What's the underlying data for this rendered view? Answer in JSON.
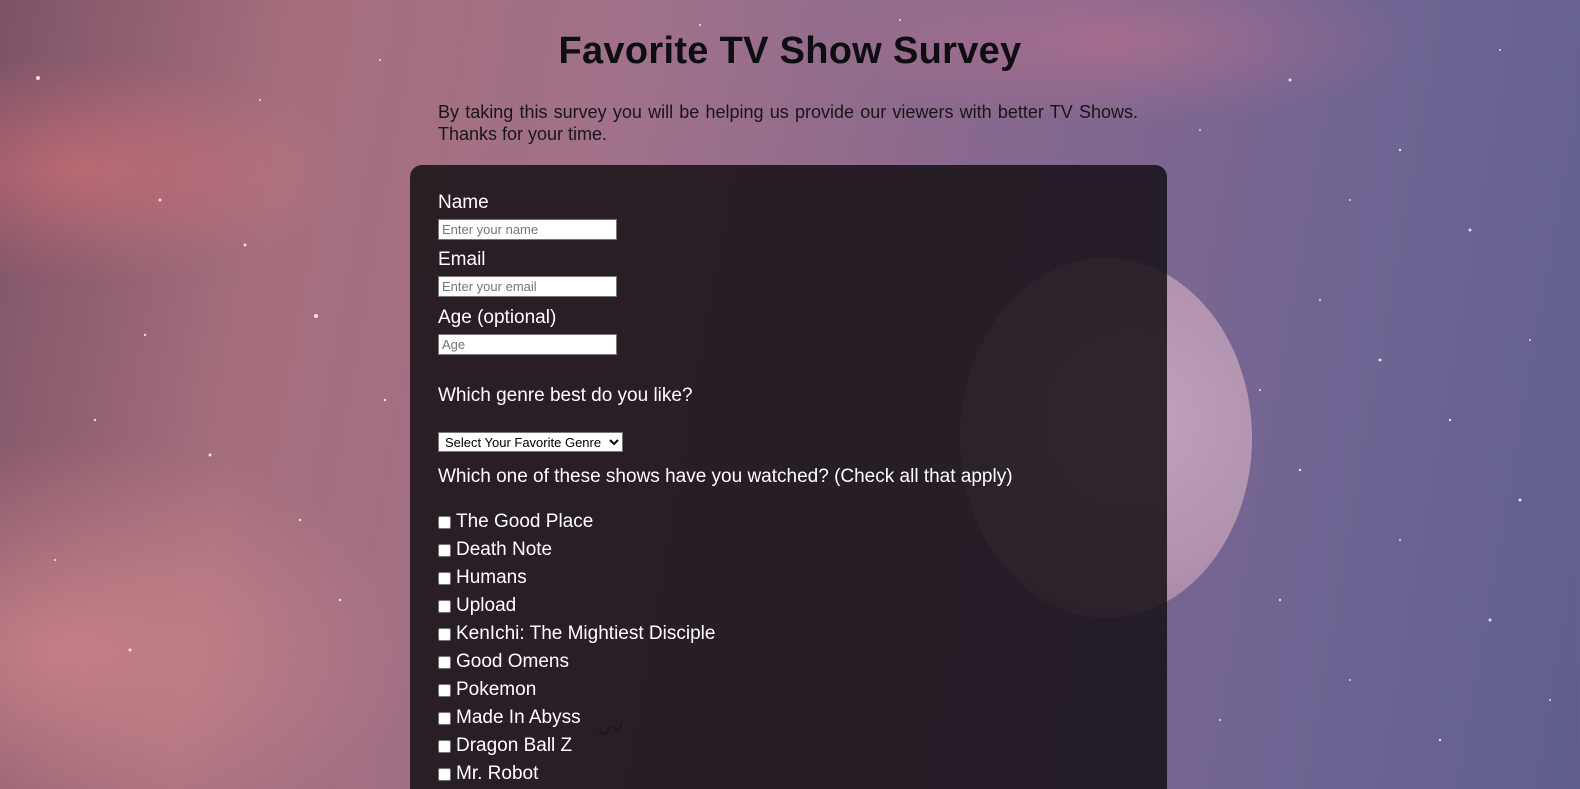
{
  "header": {
    "title": "Favorite TV Show Survey",
    "description": "By taking this survey you will be helping us provide our viewers with better TV Shows. Thanks for your time."
  },
  "form": {
    "name": {
      "label": "Name",
      "placeholder": "Enter your name"
    },
    "email": {
      "label": "Email",
      "placeholder": "Enter your email"
    },
    "age": {
      "label": "Age (optional)",
      "placeholder": "Age"
    },
    "genre": {
      "question": "Which genre best do you like?",
      "selected": "Select Your Favorite Genre"
    },
    "shows": {
      "question": "Which one of these shows have you watched? (Check all that apply)",
      "items": [
        {
          "label": "The Good Place",
          "checked": false
        },
        {
          "label": "Death Note",
          "checked": false
        },
        {
          "label": "Humans",
          "checked": false
        },
        {
          "label": "Upload",
          "checked": false
        },
        {
          "label": "KenIchi: The Mightiest Disciple",
          "checked": false
        },
        {
          "label": "Good Omens",
          "checked": false
        },
        {
          "label": "Pokemon",
          "checked": false
        },
        {
          "label": "Made In Abyss",
          "checked": false
        },
        {
          "label": "Dragon Ball Z",
          "checked": false
        },
        {
          "label": "Mr. Robot",
          "checked": false
        }
      ]
    }
  },
  "colors": {
    "panel_background": "#16101699",
    "text_on_panel": "#ffffff",
    "title_text": "#0d0d12"
  }
}
